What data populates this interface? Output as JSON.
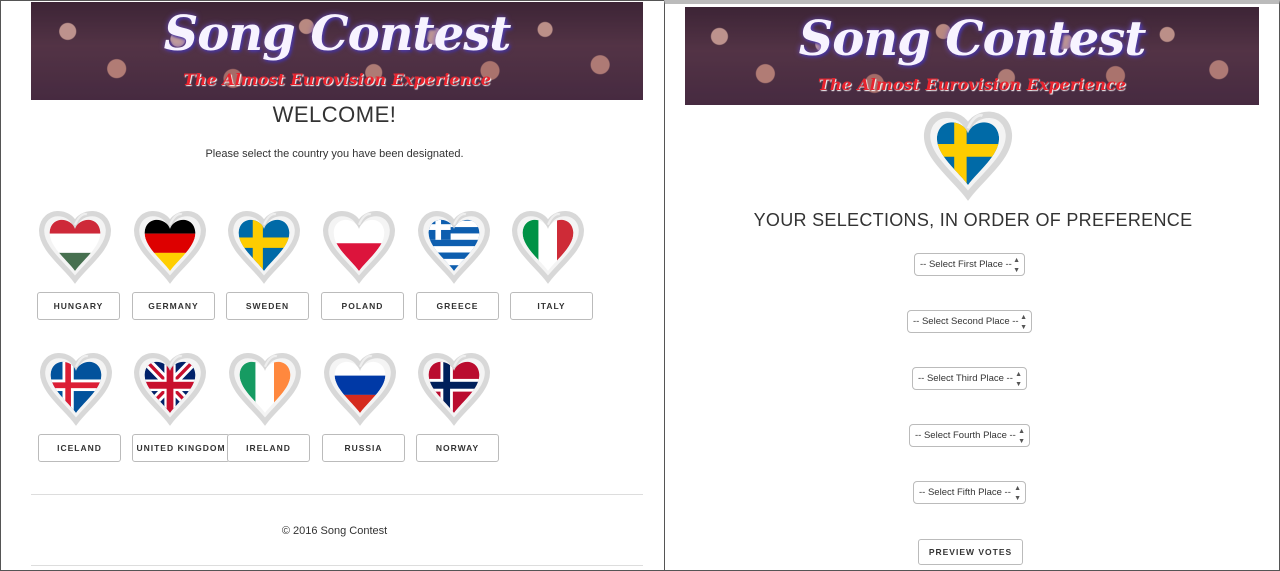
{
  "banner": {
    "title": "Song Contest",
    "subtitle": "The Almost Eurovision Experience"
  },
  "left": {
    "heading": "WELCOME!",
    "instruction": "Please select the country you have been designated.",
    "countries": [
      {
        "label": "HUNGARY",
        "flag": "hungary-flag-heart-icon"
      },
      {
        "label": "GERMANY",
        "flag": "germany-flag-heart-icon"
      },
      {
        "label": "SWEDEN",
        "flag": "sweden-flag-heart-icon"
      },
      {
        "label": "POLAND",
        "flag": "poland-flag-heart-icon"
      },
      {
        "label": "GREECE",
        "flag": "greece-flag-heart-icon"
      },
      {
        "label": "ITALY",
        "flag": "italy-flag-heart-icon"
      },
      {
        "label": "ICELAND",
        "flag": "iceland-flag-heart-icon"
      },
      {
        "label": "UNITED KINGDOM",
        "flag": "uk-flag-heart-icon"
      },
      {
        "label": "IRELAND",
        "flag": "ireland-flag-heart-icon"
      },
      {
        "label": "RUSSIA",
        "flag": "russia-flag-heart-icon"
      },
      {
        "label": "NORWAY",
        "flag": "norway-flag-heart-icon"
      }
    ],
    "footer": "© 2016 Song Contest"
  },
  "right": {
    "selected_flag": "sweden-flag-heart-icon",
    "heading": "YOUR SELECTIONS, IN ORDER OF PREFERENCE",
    "selects": [
      "-- Select First Place --",
      "-- Select Second Place --",
      "-- Select Third Place --",
      "-- Select Fourth Place --",
      "-- Select Fifth Place --"
    ],
    "preview_label": "PREVIEW VOTES"
  },
  "colors": {
    "subtitle_red": "#e8232e",
    "button_border": "#bbbbbb"
  }
}
